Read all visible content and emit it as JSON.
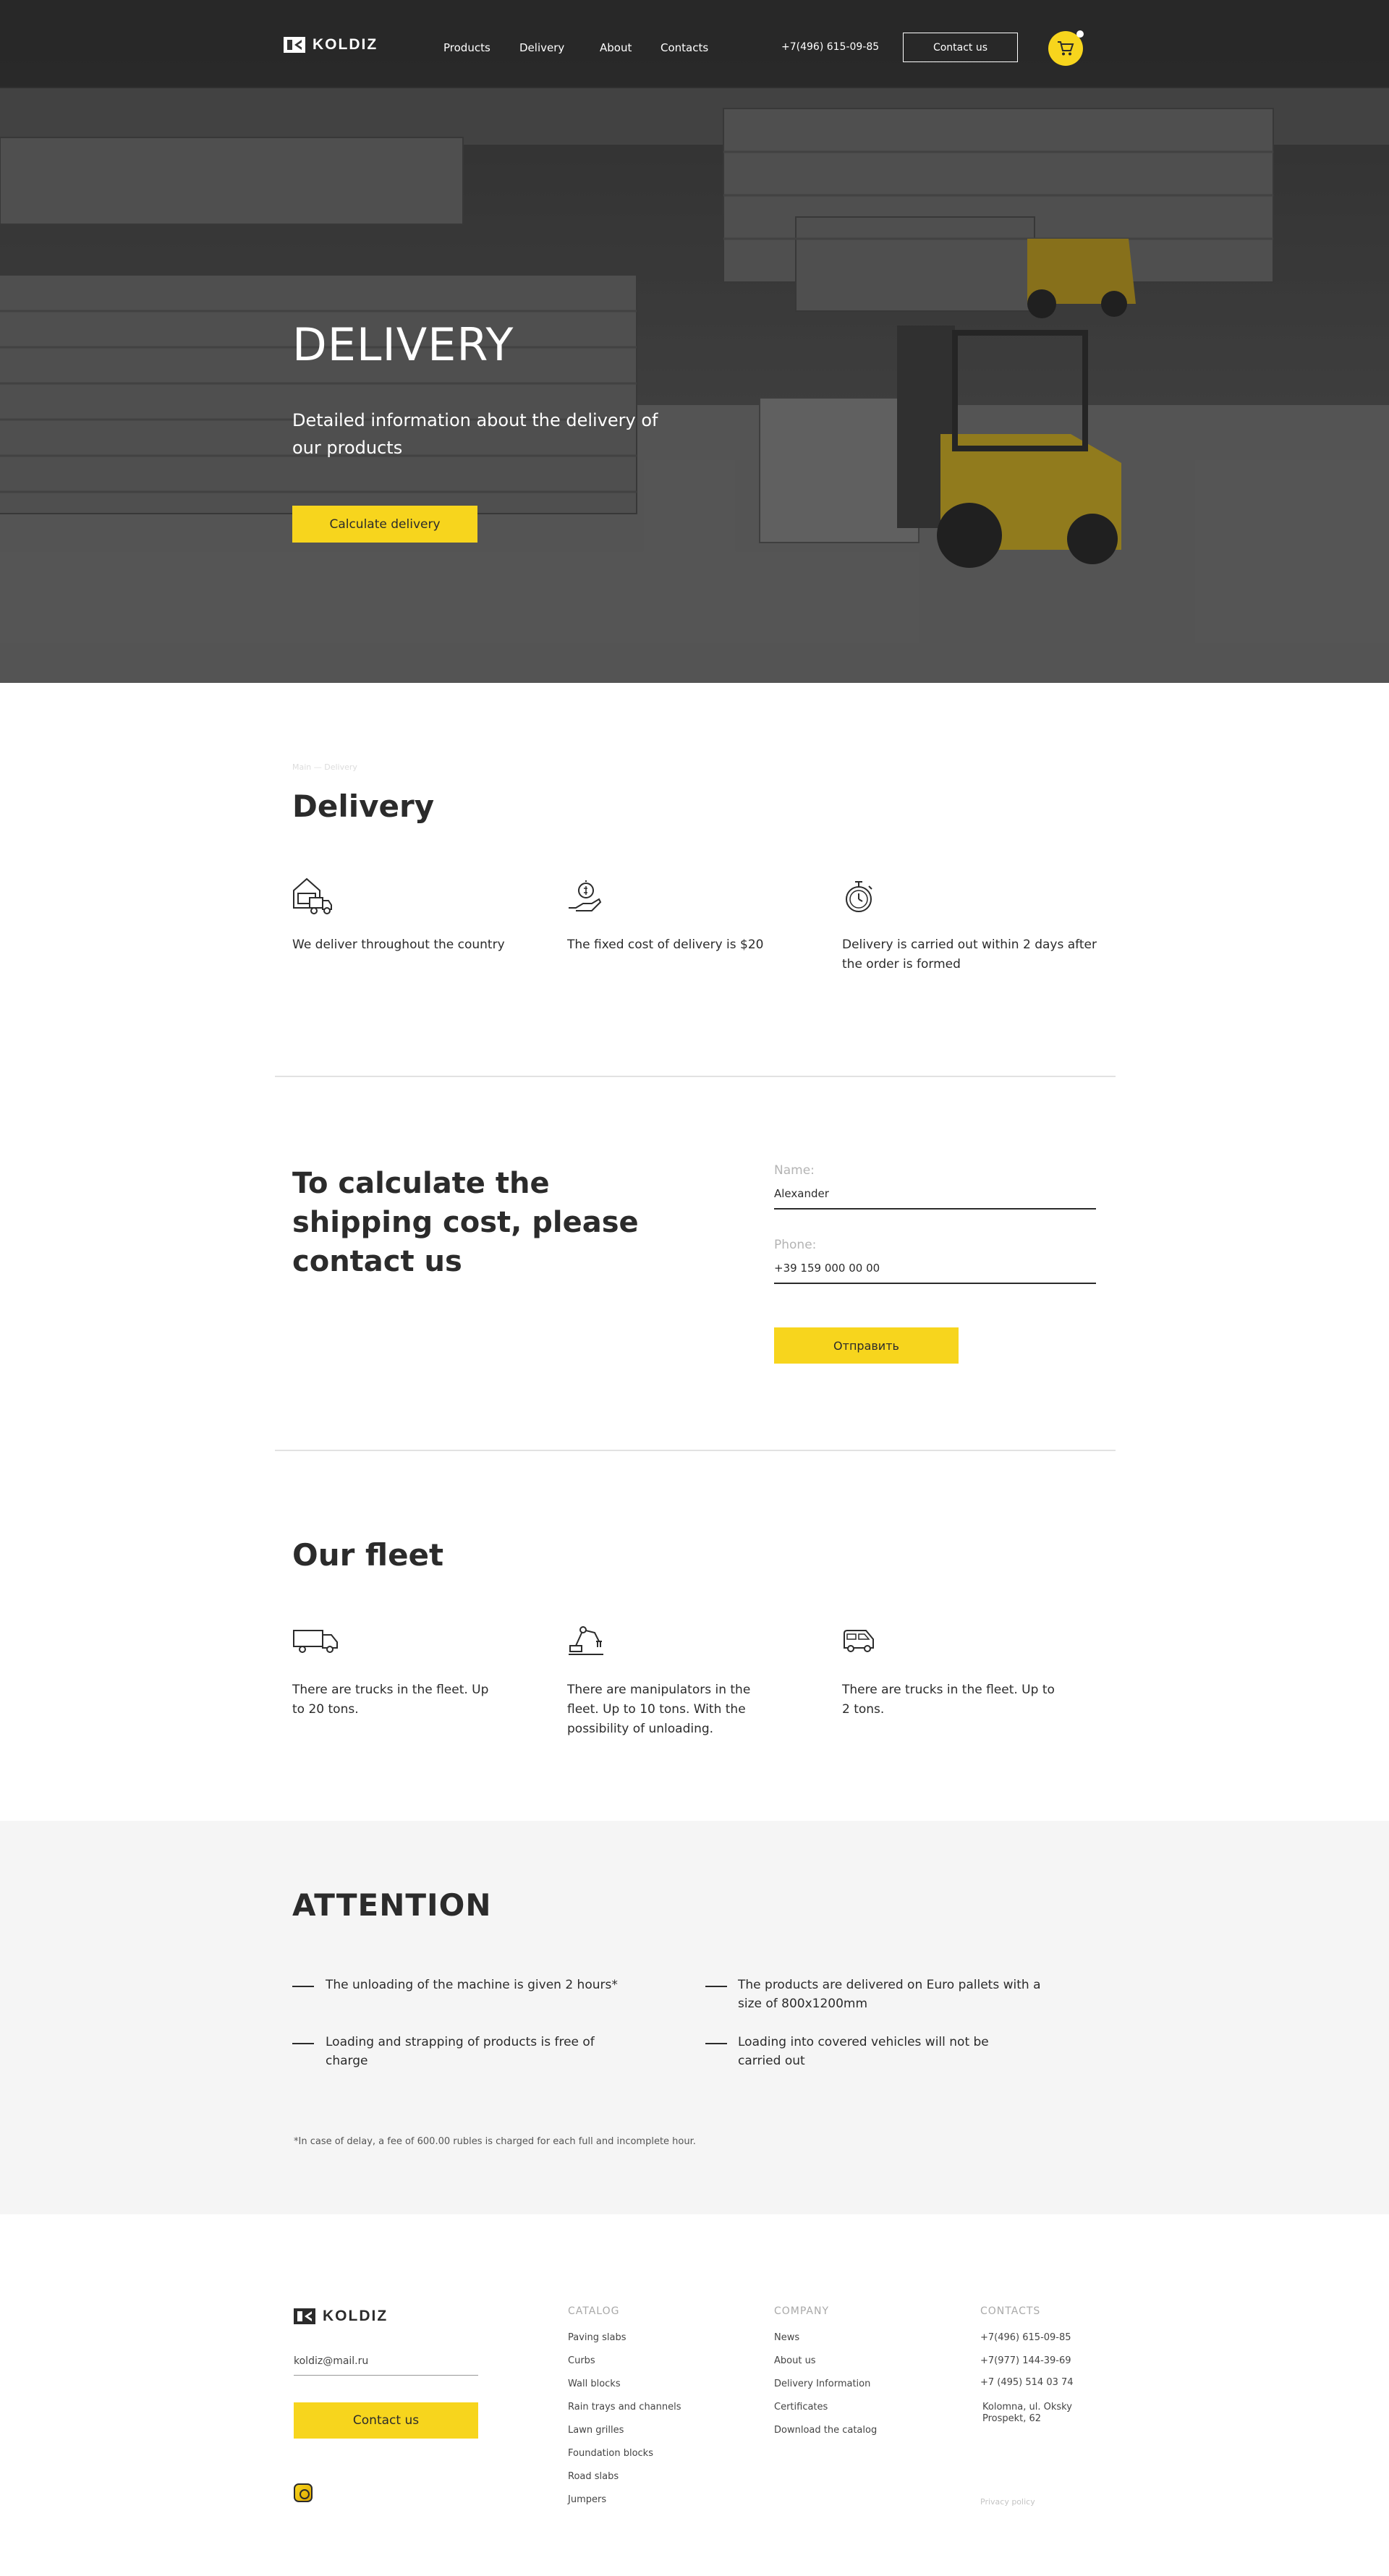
{
  "header": {
    "logo_text": "KOLDIZ",
    "nav": [
      "Products",
      "Delivery",
      "About",
      "Contacts"
    ],
    "phone": "+7(496) 615-09-85",
    "contact_button": "Contact us",
    "cart_icon": "cart-icon"
  },
  "hero": {
    "title": "DELIVERY",
    "subtitle": "Detailed information about the delivery of our products",
    "cta": "Calculate delivery"
  },
  "delivery": {
    "breadcrumb": "Main — Delivery",
    "title": "Delivery",
    "features": [
      {
        "icon": "warehouse-truck-icon",
        "text": "We deliver throughout the country"
      },
      {
        "icon": "hand-coin-icon",
        "text": "The fixed cost of delivery is $20"
      },
      {
        "icon": "stopwatch-icon",
        "text": "Delivery is carried out within 2 days after the order is formed"
      }
    ]
  },
  "calc": {
    "title": "To calculate the shipping cost, please contact us",
    "name_label": "Name:",
    "name_value": "Alexander",
    "phone_label": "Phone:",
    "phone_value": "+39 159 000 00 00",
    "submit": "Отправить"
  },
  "fleet": {
    "title": "Our fleet",
    "items": [
      {
        "icon": "truck-icon",
        "text": "There are trucks in the fleet. Up to 20 tons."
      },
      {
        "icon": "manipulator-crane-icon",
        "text": "There are manipulators in the fleet. Up to 10 tons. With the possibility of unloading."
      },
      {
        "icon": "van-icon",
        "text": "There are trucks in the fleet. Up to 2 tons."
      }
    ]
  },
  "attention": {
    "title": "ATTENTION",
    "items": [
      "The unloading of the machine is given 2 hours*",
      "The products are delivered on Euro pallets with a size of 800x1200mm",
      "Loading and strapping of products is free of charge",
      "Loading into covered vehicles will not be carried out"
    ],
    "note": "*In case of delay, a fee of 600.00 rubles is charged for each full and incomplete hour."
  },
  "footer": {
    "logo_text": "KOLDIZ",
    "email": "koldiz@mail.ru",
    "contact_button": "Contact us",
    "catalog_title": "CATALOG",
    "catalog": [
      "Paving slabs",
      "Curbs",
      "Wall blocks",
      "Rain trays and channels",
      "Lawn grilles",
      "Foundation blocks",
      "Road slabs",
      "Jumpers"
    ],
    "company_title": "COMPANY",
    "company": [
      "News",
      "About us",
      "Delivery Information",
      "Certificates",
      "Download the catalog"
    ],
    "contacts_title": "CONTACTS",
    "contacts": [
      "+7(496) 615-09-85",
      "+7(977) 144-39-69",
      "+7 (495) 514 03 74",
      "Kolomna, ul. Oksky Prospekt, 62"
    ],
    "privacy": "Privacy policy",
    "social_icon": "instagram-icon"
  },
  "colors": {
    "accent": "#f7d51d",
    "text": "#2b2b2b",
    "muted": "#b4b4b4",
    "panel": "#f5f5f5"
  }
}
